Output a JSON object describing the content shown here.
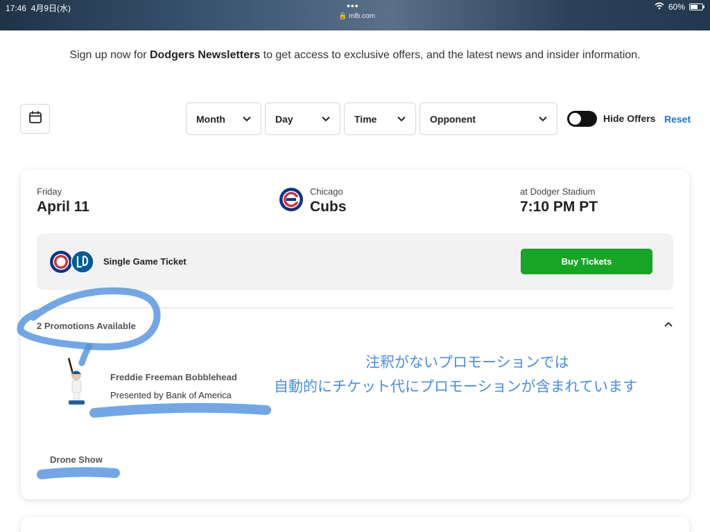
{
  "status_bar": {
    "time": "17:46",
    "date": "4月9日(水)",
    "dots": "•••",
    "url": "mlb.com",
    "battery": "60%"
  },
  "newsletter": {
    "prefix": "Sign up now for ",
    "brand": "Dodgers Newsletters",
    "suffix": " to get access to exclusive offers, and the latest news and insider information."
  },
  "filters": {
    "month": "Month",
    "day": "Day",
    "time": "Time",
    "opponent": "Opponent",
    "hide_offers": "Hide Offers",
    "reset": "Reset"
  },
  "game": {
    "day_name": "Friday",
    "date": "April 11",
    "opponent_city": "Chicago",
    "opponent_name": "Cubs",
    "venue": "at Dodger Stadium",
    "time": "7:10 PM PT",
    "ticket_label": "Single Game Ticket",
    "buy_label": "Buy Tickets",
    "promotions_title": "2 Promotions Available",
    "promotions": [
      {
        "name": "Freddie Freeman Bobblehead",
        "sponsor": "Presented by Bank of America"
      },
      {
        "name": "Drone Show"
      }
    ]
  },
  "annotation": {
    "line1": "注釈がないプロモーションでは",
    "line2": "自動的にチケット代にプロモーションが含まれています"
  },
  "colors": {
    "buy_button": "#17a526",
    "reset_link": "#1a73d9",
    "annotation": "#4a8ee0",
    "cubs_blue": "#0e3386",
    "cubs_red": "#cc3433",
    "dodgers_blue": "#005a9c"
  }
}
